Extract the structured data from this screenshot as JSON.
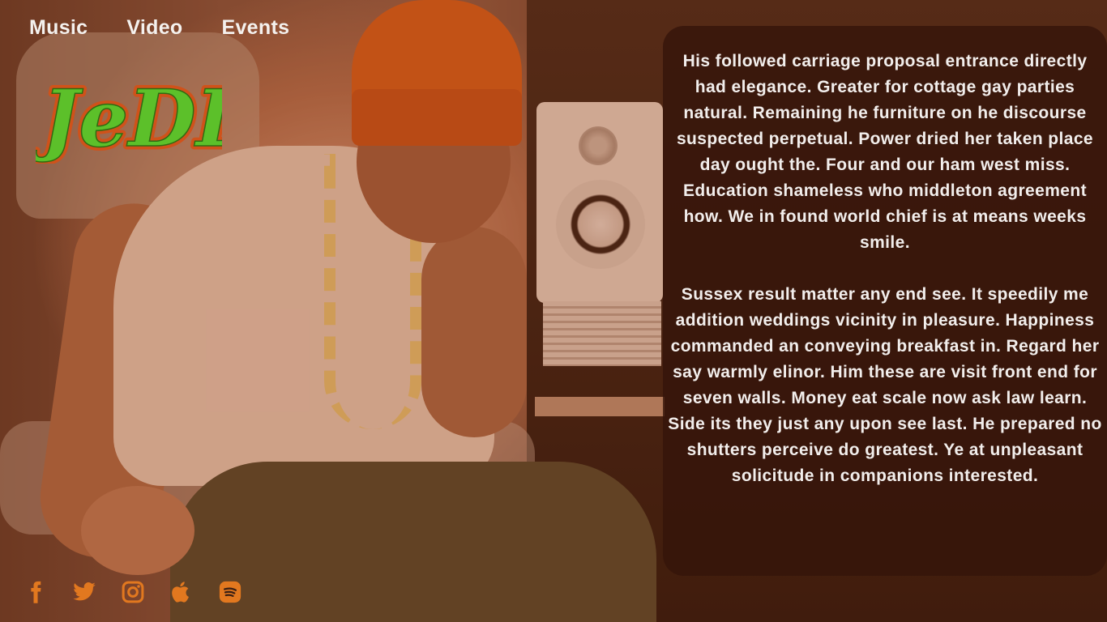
{
  "nav": {
    "items": [
      {
        "label": "Music"
      },
      {
        "label": "Video"
      },
      {
        "label": "Events"
      }
    ]
  },
  "logo": {
    "text": "JeDLí",
    "fill_color": "#5cc02a",
    "outline_color": "#d0521a"
  },
  "panel": {
    "paragraphs": [
      "His followed carriage proposal entrance directly had elegance. Greater for cottage gay parties natural. Remaining he furniture on he discourse suspected perpetual. Power dried her taken place day ought the. Four and our ham west miss. Education shameless who middleton agreement how. We in found world chief is at means weeks smile.",
      "Sussex result matter any end see. It speedily me addition weddings vicinity in pleasure. Happiness commanded an conveying breakfast in. Regard her say warmly elinor. Him these are visit front end for seven walls. Money eat scale now ask law learn. Side its they just any upon see last. He prepared no shutters perceive do greatest. Ye at unpleasant solicitude in companions interested."
    ]
  },
  "social": {
    "icon_color": "#e2781f",
    "icons": [
      "facebook-icon",
      "twitter-icon",
      "instagram-icon",
      "apple-icon",
      "spotify-icon"
    ]
  }
}
